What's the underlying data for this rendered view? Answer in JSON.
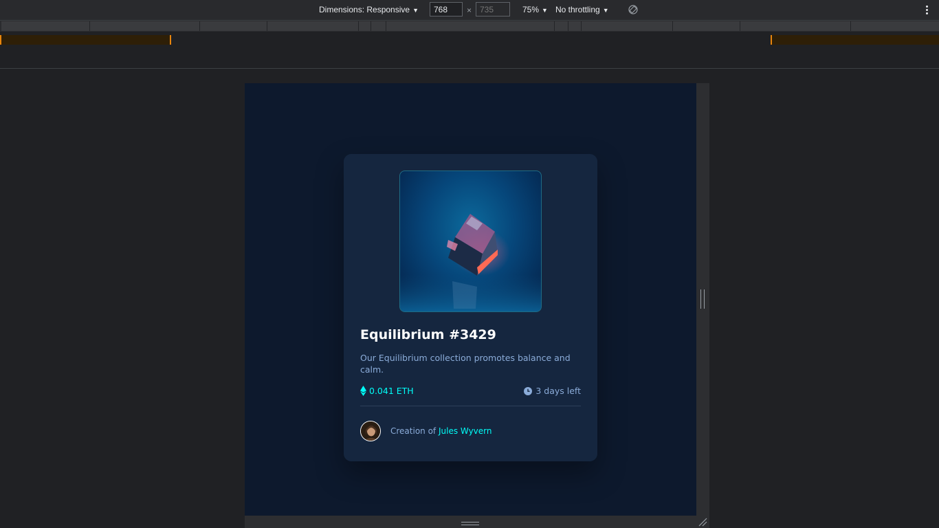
{
  "toolbar": {
    "dimensions_label": "Dimensions: Responsive",
    "width_value": "768",
    "height_placeholder": "735",
    "times_symbol": "×",
    "zoom_label": "75%",
    "throttling_label": "No throttling",
    "icons": [
      "rotate-icon",
      "more-options-icon",
      "caret-down-icon"
    ]
  },
  "nft_card": {
    "title": "Equilibrium #3429",
    "description": "Our Equilibrium collection promotes balance and calm.",
    "price": "0.041 ETH",
    "time_left": "3 days left",
    "creation_prefix": "Creation of",
    "creator_name": "Jules Wyvern",
    "icons": [
      "ethereum-icon",
      "clock-icon"
    ],
    "colors": {
      "page_bg": "#0d192d",
      "card_bg": "#15263f",
      "cyan": "#00fff8",
      "soft_blue": "#8bacd9",
      "white": "#ffffff"
    }
  }
}
